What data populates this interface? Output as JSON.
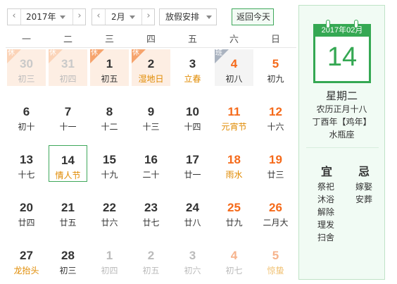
{
  "toolbar": {
    "year_value": "2017年",
    "month_value": "2月",
    "holiday_select": "放假安排",
    "today_button": "返回今天"
  },
  "weekdays": [
    "一",
    "二",
    "三",
    "四",
    "五",
    "六",
    "日"
  ],
  "colors": {
    "accent_green": "#35a853",
    "holiday_orange": "#f56a1a",
    "festival_orange": "#e08a00"
  },
  "days": [
    {
      "day": "30",
      "lunar": "初三",
      "other": true,
      "badge": "休",
      "hol": true
    },
    {
      "day": "31",
      "lunar": "初四",
      "other": true,
      "badge": "休",
      "hol": true
    },
    {
      "day": "1",
      "lunar": "初五",
      "badge": "休",
      "hol": true
    },
    {
      "day": "2",
      "lunar": "湿地日",
      "badge": "休",
      "hol": true,
      "orange": true
    },
    {
      "day": "3",
      "lunar": "立春",
      "orange": true
    },
    {
      "day": "4",
      "lunar": "初八",
      "badge": "班",
      "work": true,
      "wkend": true
    },
    {
      "day": "5",
      "lunar": "初九",
      "wkend": true
    },
    {
      "day": "6",
      "lunar": "初十"
    },
    {
      "day": "7",
      "lunar": "十一"
    },
    {
      "day": "8",
      "lunar": "十二"
    },
    {
      "day": "9",
      "lunar": "十三"
    },
    {
      "day": "10",
      "lunar": "十四"
    },
    {
      "day": "11",
      "lunar": "元宵节",
      "wkend": true,
      "orange": true
    },
    {
      "day": "12",
      "lunar": "十六",
      "wkend": true
    },
    {
      "day": "13",
      "lunar": "十七"
    },
    {
      "day": "14",
      "lunar": "情人节",
      "today": true,
      "orange": true
    },
    {
      "day": "15",
      "lunar": "十九"
    },
    {
      "day": "16",
      "lunar": "二十"
    },
    {
      "day": "17",
      "lunar": "廿一"
    },
    {
      "day": "18",
      "lunar": "雨水",
      "wkend": true,
      "orange": true
    },
    {
      "day": "19",
      "lunar": "廿三",
      "wkend": true
    },
    {
      "day": "20",
      "lunar": "廿四"
    },
    {
      "day": "21",
      "lunar": "廿五"
    },
    {
      "day": "22",
      "lunar": "廿六"
    },
    {
      "day": "23",
      "lunar": "廿七"
    },
    {
      "day": "24",
      "lunar": "廿八"
    },
    {
      "day": "25",
      "lunar": "廿九",
      "wkend": true
    },
    {
      "day": "26",
      "lunar": "二月大",
      "wkend": true
    },
    {
      "day": "27",
      "lunar": "龙抬头",
      "orange": true
    },
    {
      "day": "28",
      "lunar": "初三"
    },
    {
      "day": "1",
      "lunar": "初四",
      "other": true
    },
    {
      "day": "2",
      "lunar": "初五",
      "other": true
    },
    {
      "day": "3",
      "lunar": "初六",
      "other": true
    },
    {
      "day": "4",
      "lunar": "初七",
      "other": true,
      "wkend": true
    },
    {
      "day": "5",
      "lunar": "惊蛰",
      "other": true,
      "wkend": true,
      "orange": true
    }
  ],
  "panel": {
    "header": "2017年02月",
    "big_day": "14",
    "weekday": "星期二",
    "lunar": "农历正月十八",
    "ganzhi": "丁酉年【鸡年】",
    "zodiac": "水瓶座",
    "yi_title": "宜",
    "ji_title": "忌",
    "yi": [
      "祭祀",
      "沐浴",
      "解除",
      "理发",
      "扫舍"
    ],
    "ji": [
      "嫁娶",
      "安葬"
    ]
  }
}
